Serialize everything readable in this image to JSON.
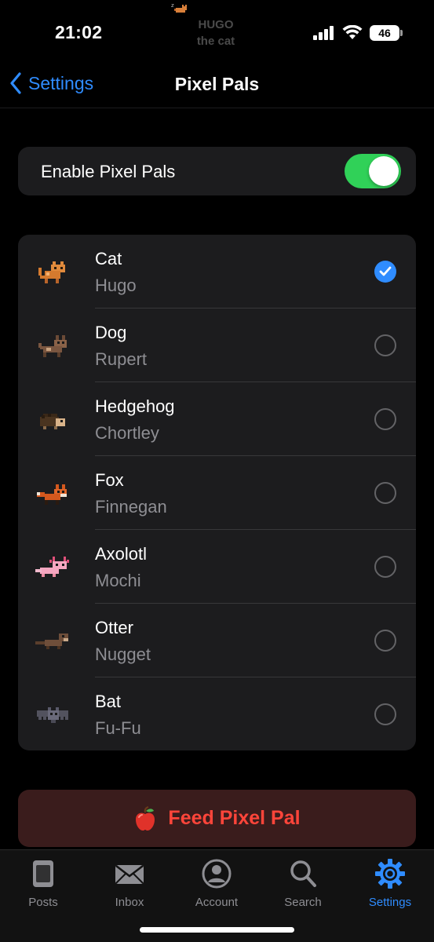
{
  "status": {
    "time": "21:02",
    "battery": "46"
  },
  "island": {
    "line1": "HUGO",
    "line2": "the cat"
  },
  "nav": {
    "back_label": "Settings",
    "title": "Pixel Pals"
  },
  "toggle": {
    "label": "Enable Pixel Pals",
    "on": true
  },
  "pals": [
    {
      "name": "Cat",
      "pet": "Hugo",
      "selected": true,
      "icon": "cat-sprite-icon"
    },
    {
      "name": "Dog",
      "pet": "Rupert",
      "selected": false,
      "icon": "dog-sprite-icon"
    },
    {
      "name": "Hedgehog",
      "pet": "Chortley",
      "selected": false,
      "icon": "hedgehog-sprite-icon"
    },
    {
      "name": "Fox",
      "pet": "Finnegan",
      "selected": false,
      "icon": "fox-sprite-icon"
    },
    {
      "name": "Axolotl",
      "pet": "Mochi",
      "selected": false,
      "icon": "axolotl-sprite-icon"
    },
    {
      "name": "Otter",
      "pet": "Nugget",
      "selected": false,
      "icon": "otter-sprite-icon"
    },
    {
      "name": "Bat",
      "pet": "Fu-Fu",
      "selected": false,
      "icon": "bat-sprite-icon"
    }
  ],
  "feed_button": {
    "label": "Feed Pixel Pal",
    "icon": "apple-icon"
  },
  "tabs": [
    {
      "label": "Posts",
      "icon": "posts-icon",
      "active": false
    },
    {
      "label": "Inbox",
      "icon": "inbox-icon",
      "active": false
    },
    {
      "label": "Account",
      "icon": "account-icon",
      "active": false
    },
    {
      "label": "Search",
      "icon": "search-icon",
      "active": false
    },
    {
      "label": "Settings",
      "icon": "gear-icon",
      "active": true
    }
  ],
  "colors": {
    "accent": "#2f8cff",
    "toggle_on": "#30d158",
    "destructive": "#ff453a",
    "card": "#1c1c1e"
  }
}
